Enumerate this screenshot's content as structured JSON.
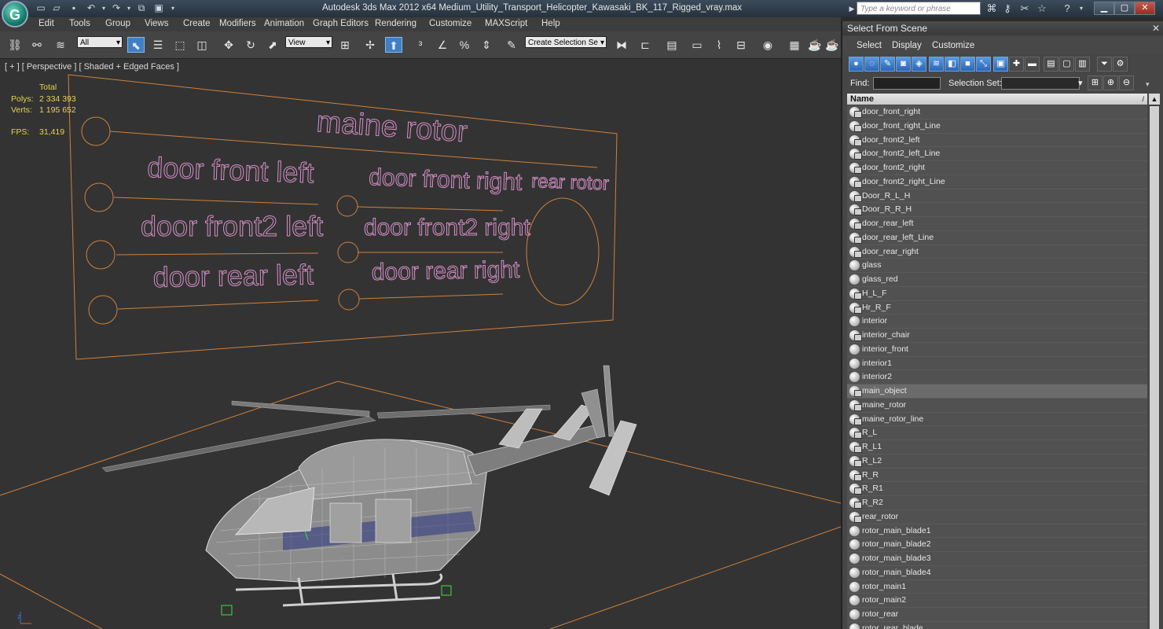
{
  "window": {
    "title": "Autodesk 3ds Max  2012 x64     Medium_Utility_Transport_Helicopter_Kawasaki_BK_117_Rigged_vray.max",
    "search_placeholder": "Type a keyword or phrase"
  },
  "menu": [
    "Edit",
    "Tools",
    "Group",
    "Views",
    "Create",
    "Modifiers",
    "Animation",
    "Graph Editors",
    "Rendering",
    "Customize",
    "MAXScript",
    "Help"
  ],
  "toolbar": {
    "filter_value": "All",
    "refcoord_value": "View",
    "selection_set_value": "Create Selection Se"
  },
  "viewport": {
    "label": "[ + ] [ Perspective ] [ Shaded + Edged Faces ]",
    "stats": {
      "total_label": "Total",
      "polys_label": "Polys:",
      "polys_value": "2 334 393",
      "verts_label": "Verts:",
      "verts_value": "1 195 652",
      "fps_label": "FPS:",
      "fps_value": "31,419"
    },
    "shape_labels": {
      "maine_rotor": "maine rotor",
      "door_front_left": "door front left",
      "door_front_right": "door front right",
      "rear_rotor": "rear rotor",
      "door_front2_left": "door front2 left",
      "door_front2_right": "door front2 right",
      "door_rear_left": "door rear left",
      "door_rear_right": "door rear right"
    }
  },
  "select_from_scene": {
    "title": "Select From Scene",
    "menu": [
      "Select",
      "Display",
      "Customize"
    ],
    "find_label": "Find:",
    "selection_set_label": "Selection Set:",
    "column_name": "Name",
    "items": [
      {
        "name": "door_front_right",
        "icon": "grp"
      },
      {
        "name": "door_front_right_Line",
        "icon": "grp"
      },
      {
        "name": "door_front2_left",
        "icon": "grp"
      },
      {
        "name": "door_front2_left_Line",
        "icon": "grp"
      },
      {
        "name": "door_front2_right",
        "icon": "grp"
      },
      {
        "name": "door_front2_right_Line",
        "icon": "grp"
      },
      {
        "name": "Door_R_L_H",
        "icon": "grp"
      },
      {
        "name": "Door_R_R_H",
        "icon": "grp"
      },
      {
        "name": "door_rear_left",
        "icon": "grp"
      },
      {
        "name": "door_rear_left_Line",
        "icon": "grp"
      },
      {
        "name": "door_rear_right",
        "icon": "grp"
      },
      {
        "name": "glass",
        "icon": "obj"
      },
      {
        "name": "glass_red",
        "icon": "obj"
      },
      {
        "name": "H_L_F",
        "icon": "grp"
      },
      {
        "name": "Hr_R_F",
        "icon": "grp"
      },
      {
        "name": "interior",
        "icon": "obj"
      },
      {
        "name": "interior_chair",
        "icon": "grp"
      },
      {
        "name": "interior_front",
        "icon": "obj"
      },
      {
        "name": "interior1",
        "icon": "obj"
      },
      {
        "name": "interior2",
        "icon": "obj"
      },
      {
        "name": "main_object",
        "icon": "grp",
        "selected": true
      },
      {
        "name": "maine_rotor",
        "icon": "grp"
      },
      {
        "name": "maine_rotor_line",
        "icon": "grp"
      },
      {
        "name": "R_L",
        "icon": "grp"
      },
      {
        "name": "R_L1",
        "icon": "grp"
      },
      {
        "name": "R_L2",
        "icon": "grp"
      },
      {
        "name": "R_R",
        "icon": "grp"
      },
      {
        "name": "R_R1",
        "icon": "grp"
      },
      {
        "name": "R_R2",
        "icon": "grp"
      },
      {
        "name": "rear_rotor",
        "icon": "grp"
      },
      {
        "name": "rotor_main_blade1",
        "icon": "obj"
      },
      {
        "name": "rotor_main_blade2",
        "icon": "obj"
      },
      {
        "name": "rotor_main_blade3",
        "icon": "obj"
      },
      {
        "name": "rotor_main_blade4",
        "icon": "obj"
      },
      {
        "name": "rotor_main1",
        "icon": "obj"
      },
      {
        "name": "rotor_main2",
        "icon": "obj"
      },
      {
        "name": "rotor_rear",
        "icon": "obj"
      },
      {
        "name": "rotor_rear_blade",
        "icon": "obj"
      }
    ]
  }
}
